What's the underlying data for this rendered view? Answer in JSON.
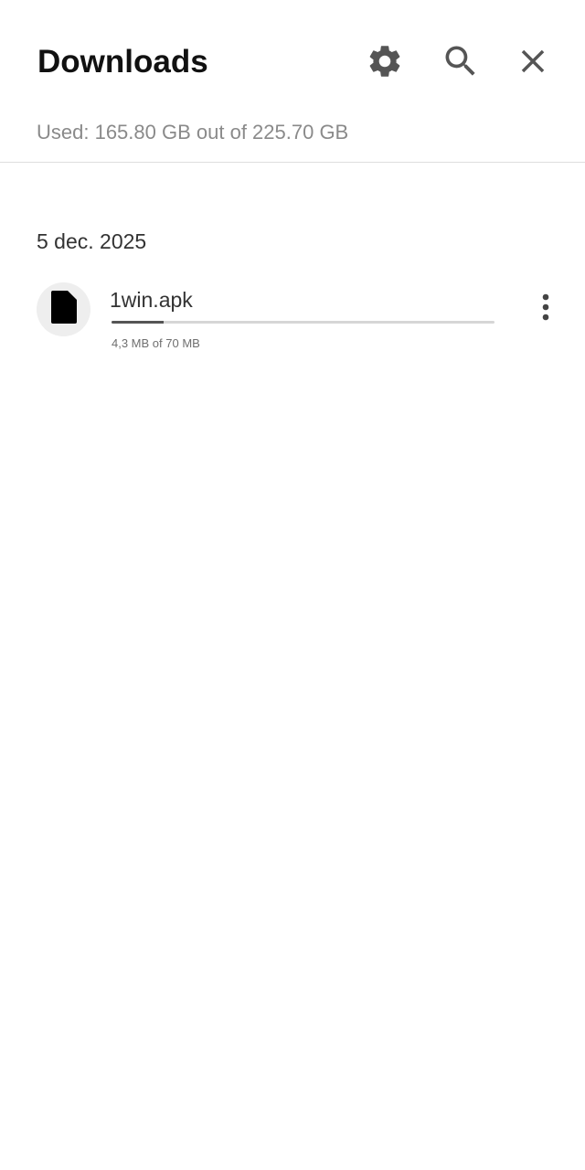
{
  "header": {
    "title": "Downloads",
    "icons": {
      "settings": "gear-icon",
      "search": "search-icon",
      "close": "close-icon"
    }
  },
  "storage": {
    "text": "Used: 165.80 GB out of 225.70 GB"
  },
  "groups": [
    {
      "date": "5 dec. 2025",
      "items": [
        {
          "file_name": "1win.apk",
          "icon": "file-icon",
          "size_text": "4,3 MB of 70 MB",
          "progress_fraction": 0.135,
          "menu_icon": "more-vert-icon"
        }
      ]
    }
  ],
  "colors": {
    "icon": "#555555",
    "progress_fill": "#555555",
    "progress_track": "#d6d6d6"
  }
}
